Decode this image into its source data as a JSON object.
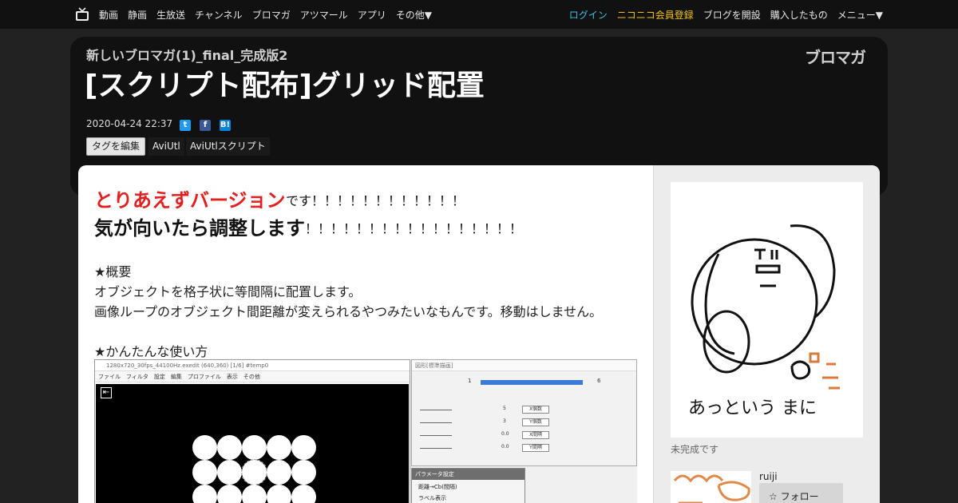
{
  "nav": {
    "left_items": [
      "動画",
      "静画",
      "生放送",
      "チャンネル",
      "ブロマガ",
      "アツマール",
      "アプリ",
      "その他▼"
    ],
    "login": "ログイン",
    "register": "ニコニコ会員登録",
    "open_blog": "ブログを開設",
    "purchased": "購入したもの",
    "menu": "メニュー▼"
  },
  "header": {
    "subtitle": "新しいブロマガ(1)_final_完成版2",
    "title": "[スクリプト配布]グリッド配置",
    "logo_text": "ブロマガ",
    "date": "2020-04-24 22:37",
    "edit_tags_label": "タグを編集",
    "tags": [
      "AviUtl",
      "AviUtlスクリプト"
    ]
  },
  "article": {
    "lead_red": "とりあえずバージョン",
    "lead_rest": "です！！！！！！！！！！！！",
    "line2_big": "気が向いたら調整します",
    "line2_rest": "！！！！！！！！！！！！！！！！！",
    "overview_heading": "★概要",
    "overview_p1": "オブジェクトを格子状に等間隔に配置します。",
    "overview_p2": "画像ループのオブジェクト間距離が変えられるやつみたいなもんです。移動はしません。",
    "howto_heading": "★かんたんな使い方"
  },
  "screenshot": {
    "left_title": "1280x720_30fps_44100Hz.exedit (640,360) [1/6] #temp0",
    "left_menu": "ファイル　フィルタ　設定　編集　プロファイル　表示　その他",
    "right_title": "図形[標準描画]",
    "param_labels": [
      "X個数",
      "Y個数",
      "X間隔",
      "Y間隔"
    ],
    "param_values": [
      "5",
      "3",
      "0.0",
      "0.0"
    ],
    "param_window_title": "パラメータ設定",
    "param_window_row1": "距離→Cb(間隔)",
    "param_window_row2": "ラベル表示"
  },
  "sidebar": {
    "thumb_text": "あっという まに",
    "thumb_caption": "未完成です",
    "author": "ruiji",
    "follow_label": "フォロー"
  },
  "colors": {
    "accent_red": "#e32020",
    "login_cyan": "#3ec1e6",
    "premium_gold": "#f1c40f",
    "twitter": "#1d9bf0",
    "facebook": "#3b5998",
    "hatena": "#0a84d8"
  }
}
